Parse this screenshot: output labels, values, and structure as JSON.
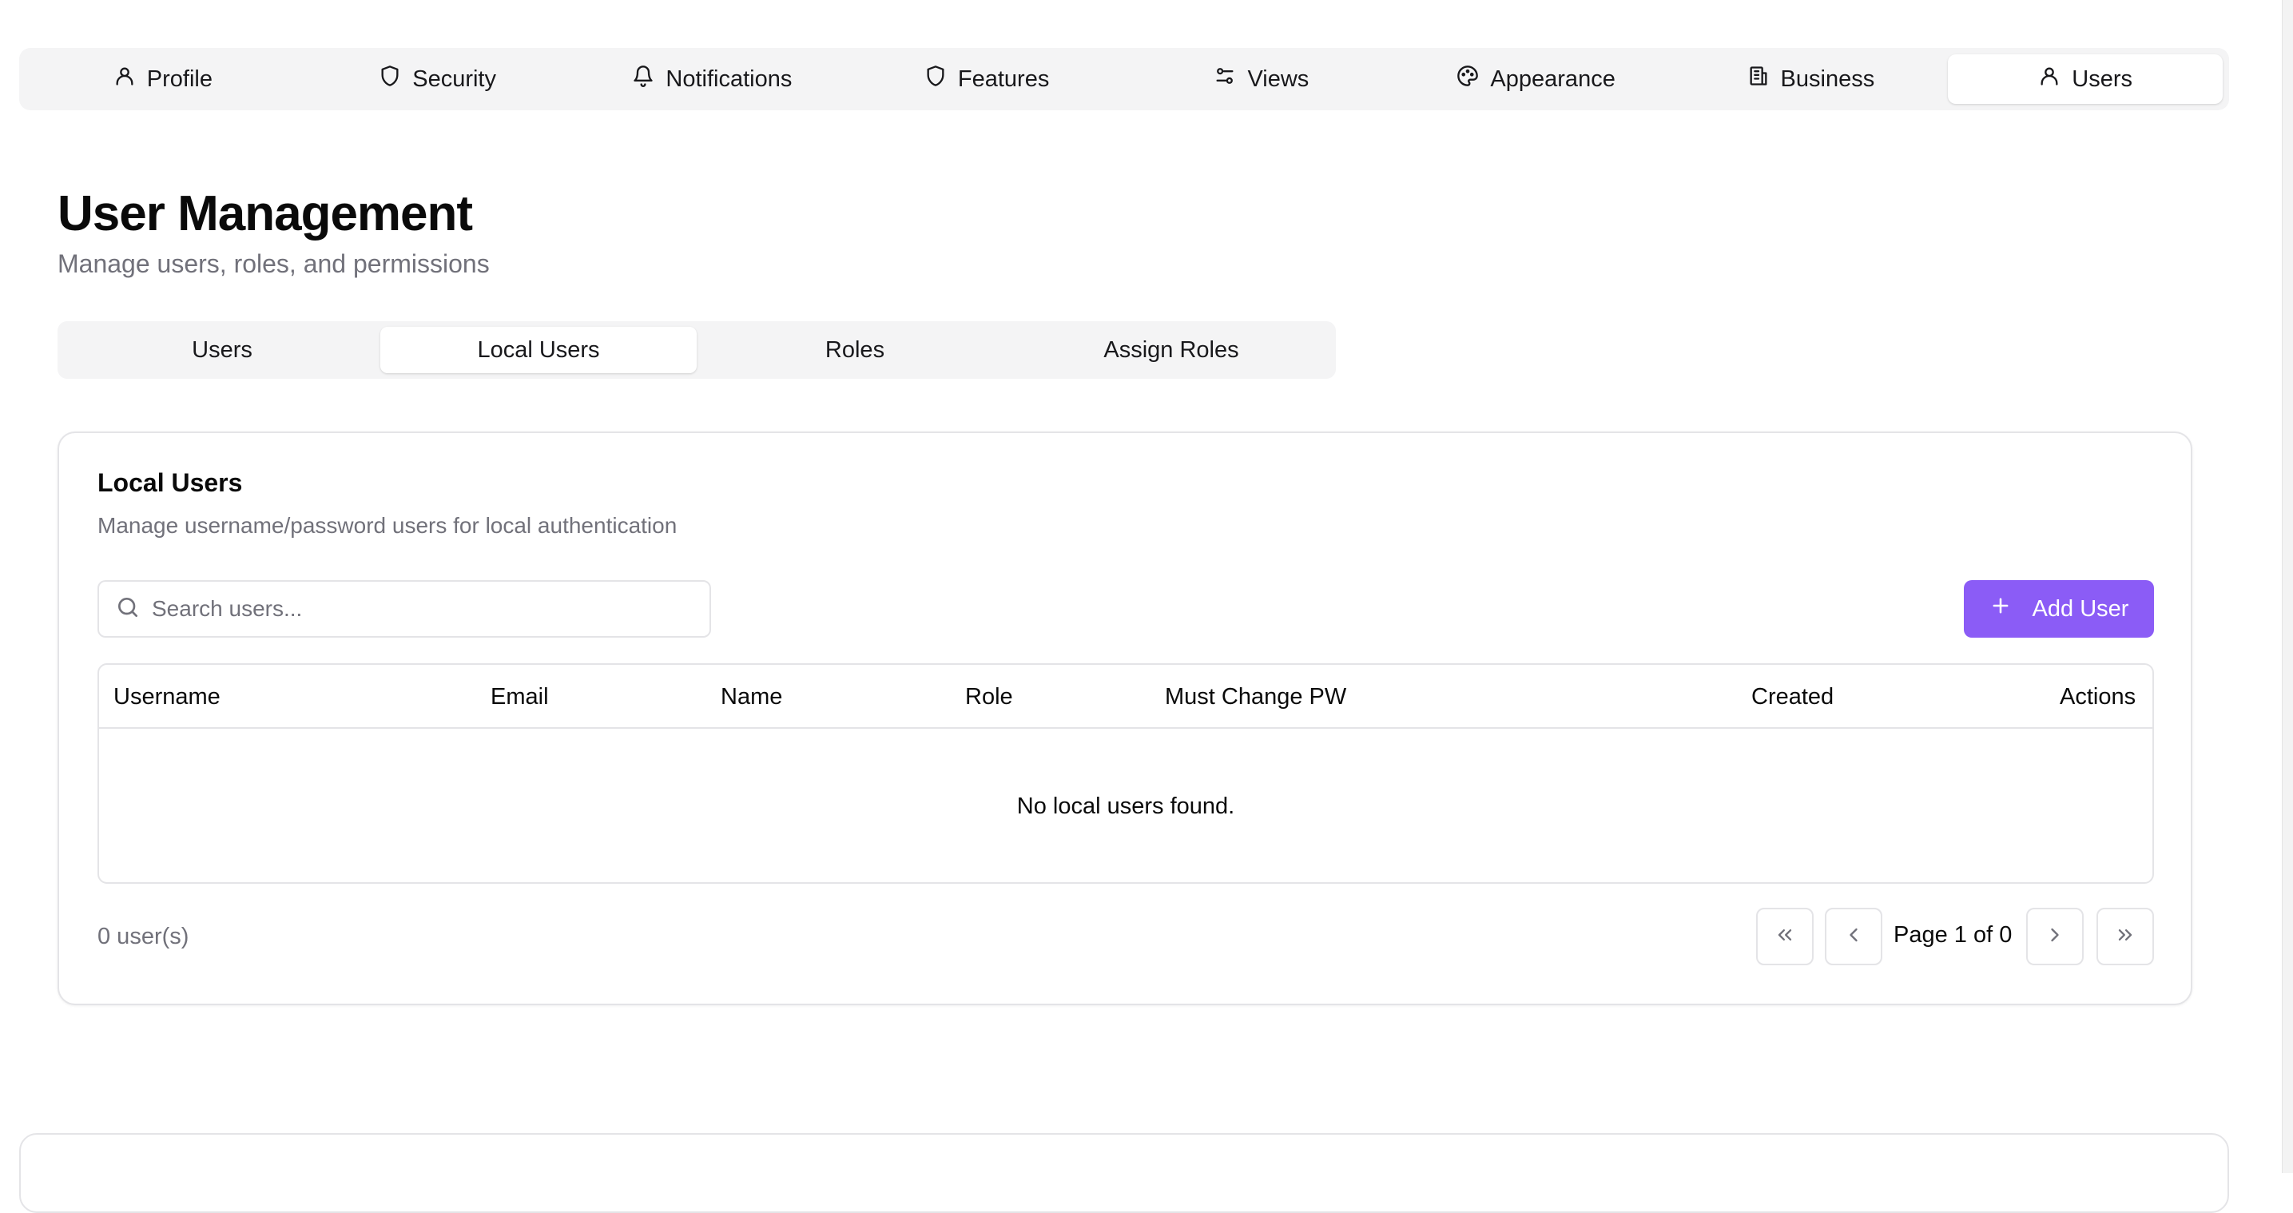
{
  "top_nav": {
    "items": [
      {
        "label": "Profile",
        "icon": "user-icon"
      },
      {
        "label": "Security",
        "icon": "shield-icon"
      },
      {
        "label": "Notifications",
        "icon": "bell-icon"
      },
      {
        "label": "Features",
        "icon": "shield-icon"
      },
      {
        "label": "Views",
        "icon": "sliders-icon"
      },
      {
        "label": "Appearance",
        "icon": "palette-icon"
      },
      {
        "label": "Business",
        "icon": "building-icon"
      },
      {
        "label": "Users",
        "icon": "user-icon"
      }
    ],
    "active": "Users"
  },
  "header": {
    "title": "User Management",
    "subtitle": "Manage users, roles, and permissions"
  },
  "sub_tabs": {
    "items": [
      "Users",
      "Local Users",
      "Roles",
      "Assign Roles"
    ],
    "active": "Local Users"
  },
  "card": {
    "title": "Local Users",
    "description": "Manage username/password users for local authentication",
    "search": {
      "placeholder": "Search users...",
      "value": "",
      "icon": "search-icon"
    },
    "add_button": {
      "label": "Add User",
      "icon": "plus-icon"
    },
    "table": {
      "columns": [
        "Username",
        "Email",
        "Name",
        "Role",
        "Must Change PW",
        "Created",
        "Actions"
      ],
      "rows": [],
      "empty_message": "No local users found."
    },
    "footer": {
      "count_text": "0 user(s)",
      "page_text": "Page 1 of 0"
    }
  },
  "colors": {
    "accent": "#8b5cf6",
    "muted_text": "#71717a",
    "tab_background": "#f4f4f5",
    "border": "#e4e4e7"
  }
}
